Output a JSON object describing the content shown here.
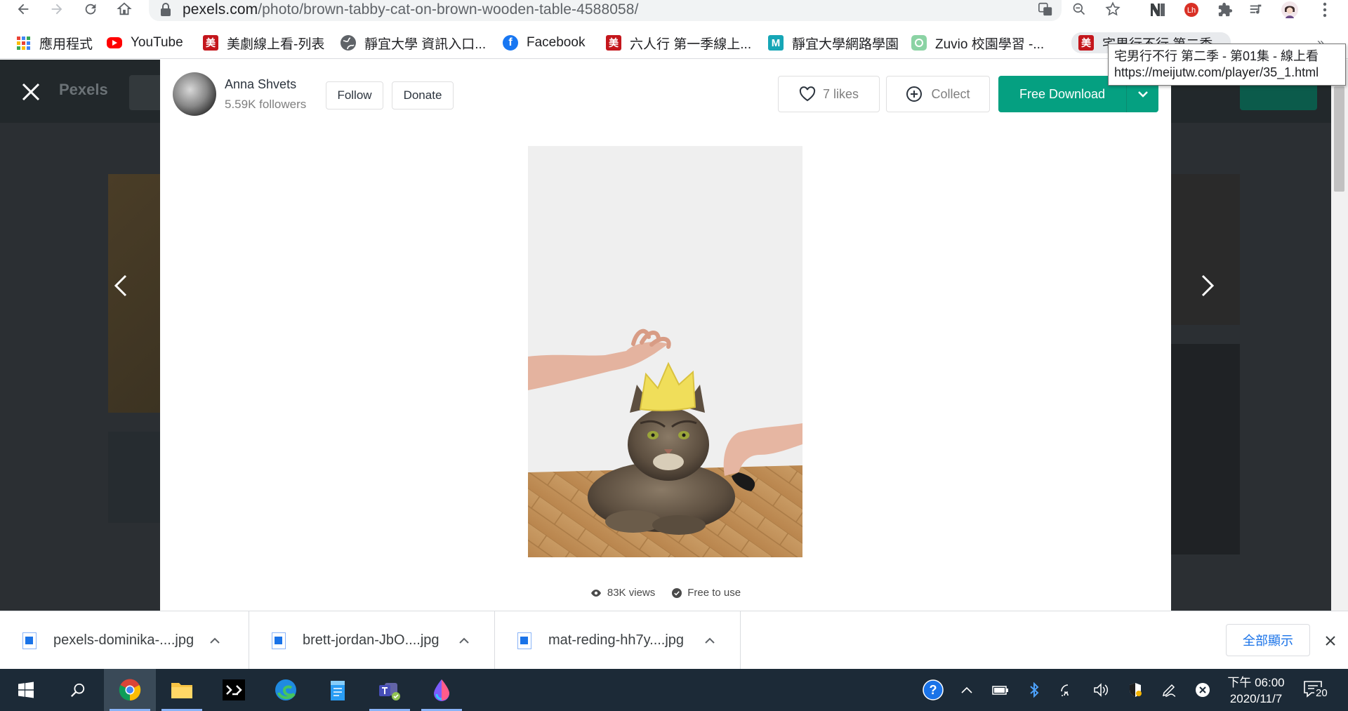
{
  "browser": {
    "url_domain": "pexels.com",
    "url_path": "/photo/brown-tabby-cat-on-brown-wooden-table-4588058/",
    "bookmarks": [
      {
        "label": "應用程式",
        "icon": "apps-grid-icon"
      },
      {
        "label": "YouTube",
        "icon": "youtube-icon"
      },
      {
        "label": "美劇線上看-列表",
        "icon": "meijutw-icon"
      },
      {
        "label": "靜宜大學 資訊入口...",
        "icon": "globe-icon"
      },
      {
        "label": "Facebook",
        "icon": "facebook-icon"
      },
      {
        "label": "六人行 第一季線上...",
        "icon": "meijutw-icon"
      },
      {
        "label": "靜宜大學網路學園",
        "icon": "moodle-icon"
      },
      {
        "label": "Zuvio 校園學習 -...",
        "icon": "zuvio-icon"
      },
      {
        "label": "宅男行不行 第二季...",
        "icon": "meijutw-icon"
      }
    ],
    "overflow_label": "»",
    "tooltip": {
      "line1": "宅男行不行 第二季 - 第01集 - 線上看",
      "line2": "https://meijutw.com/player/35_1.html"
    }
  },
  "pexels": {
    "brand": "Pexels",
    "author": {
      "name": "Anna Shvets",
      "followers": "5.59K followers"
    },
    "buttons": {
      "follow": "Follow",
      "donate": "Donate",
      "likes": "7 likes",
      "collect": "Collect",
      "download": "Free Download"
    },
    "stats": {
      "views": "83K views",
      "license": "Free to use"
    }
  },
  "downloads": {
    "items": [
      {
        "name": "pexels-dominika-....jpg"
      },
      {
        "name": "brett-jordan-JbO....jpg"
      },
      {
        "name": "mat-reding-hh7y....jpg"
      }
    ],
    "show_all": "全部顯示"
  },
  "taskbar": {
    "clock_time": "下午 06:00",
    "clock_date": "2020/11/7",
    "notification_count": "20"
  },
  "colors": {
    "accent_green": "#05a081",
    "overlay": "#2b2f33",
    "taskbar": "#1c2a37"
  }
}
